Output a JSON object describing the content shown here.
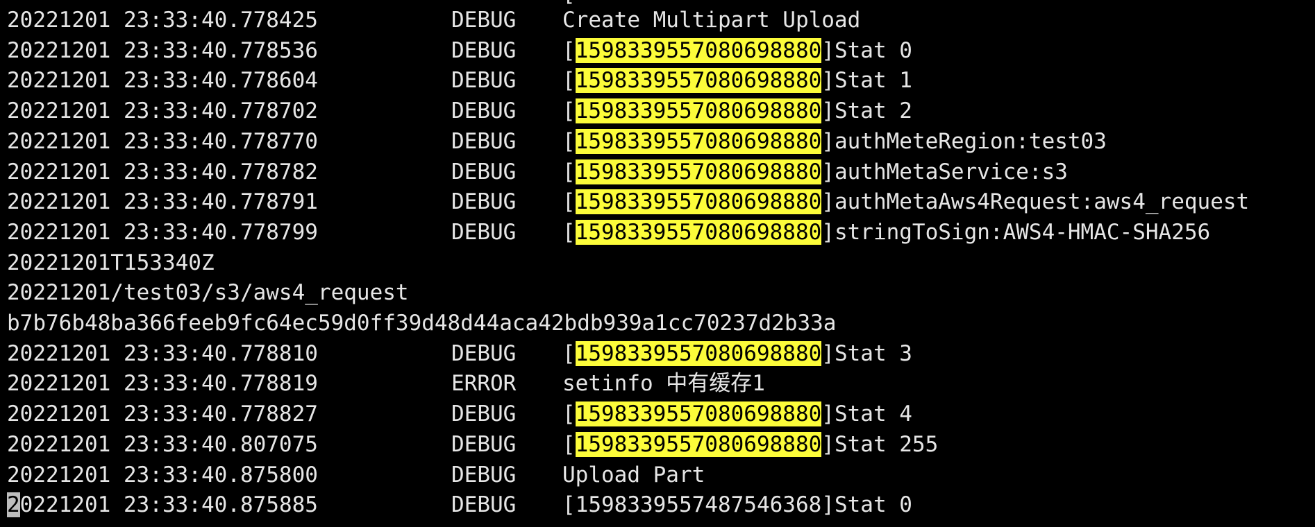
{
  "partial_top": {
    "bracket": "["
  },
  "log": [
    {
      "ts": "20221201 23:33:40.778425",
      "level": "DEBUG",
      "msg": "Create Multipart Upload"
    },
    {
      "ts": "20221201 23:33:40.778536",
      "level": "DEBUG",
      "id": "1598339557080698880",
      "rest": "Stat 0"
    },
    {
      "ts": "20221201 23:33:40.778604",
      "level": "DEBUG",
      "id": "1598339557080698880",
      "rest": "Stat 1"
    },
    {
      "ts": "20221201 23:33:40.778702",
      "level": "DEBUG",
      "id": "1598339557080698880",
      "rest": "Stat 2"
    },
    {
      "ts": "20221201 23:33:40.778770",
      "level": "DEBUG",
      "id": "1598339557080698880",
      "rest": "authMeteRegion:test03"
    },
    {
      "ts": "20221201 23:33:40.778782",
      "level": "DEBUG",
      "id": "1598339557080698880",
      "rest": "authMetaService:s3"
    },
    {
      "ts": "20221201 23:33:40.778791",
      "level": "DEBUG",
      "id": "1598339557080698880",
      "rest": "authMetaAws4Request:aws4_request"
    },
    {
      "ts": "20221201 23:33:40.778799",
      "level": "DEBUG",
      "id": "1598339557080698880",
      "rest": "stringToSign:AWS4-HMAC-SHA256"
    },
    {
      "cont": "20221201T153340Z"
    },
    {
      "cont": "20221201/test03/s3/aws4_request"
    },
    {
      "cont": "b7b76b48ba366feeb9fc64ec59d0ff39d48d44aca42bdb939a1cc70237d2b33a"
    },
    {
      "ts": "20221201 23:33:40.778810",
      "level": "DEBUG",
      "id": "1598339557080698880",
      "rest": "Stat 3"
    },
    {
      "ts": "20221201 23:33:40.778819",
      "level": "ERROR",
      "msg": "setinfo 中有缓存1"
    },
    {
      "ts": "20221201 23:33:40.778827",
      "level": "DEBUG",
      "id": "1598339557080698880",
      "rest": "Stat 4"
    },
    {
      "ts": "20221201 23:33:40.807075",
      "level": "DEBUG",
      "id": "1598339557080698880",
      "rest": "Stat 255"
    },
    {
      "ts": "20221201 23:33:40.875800",
      "level": "DEBUG",
      "msg": "Upload Part"
    },
    {
      "ts_cursor": "2",
      "ts_rest": "0221201 23:33:40.875885",
      "level": "DEBUG",
      "id_plain": "1598339557487546368",
      "rest": "Stat 0"
    }
  ],
  "colors": {
    "background": "#000000",
    "text": "#e6e6e6",
    "highlight": "#fcfc3a",
    "cursor": "#bdbdbd"
  }
}
